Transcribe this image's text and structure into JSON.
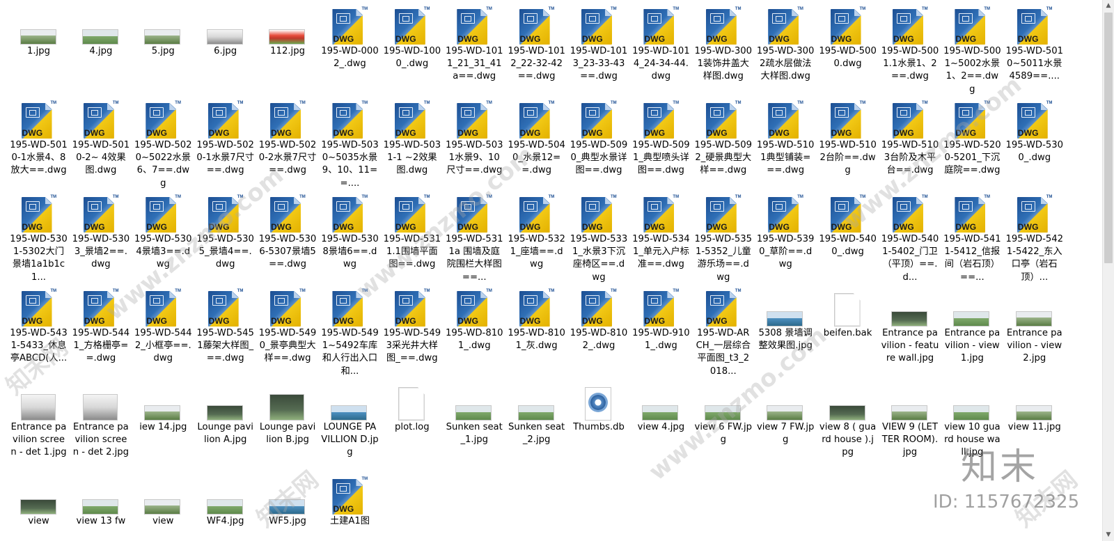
{
  "files": [
    {
      "name": "1.jpg",
      "type": "img",
      "thumb": "t2"
    },
    {
      "name": "4.jpg",
      "type": "img",
      "thumb": "t1"
    },
    {
      "name": "5.jpg",
      "type": "img",
      "thumb": "t2"
    },
    {
      "name": "6.jpg",
      "type": "img",
      "thumb": "t4"
    },
    {
      "name": "112.jpg",
      "type": "img",
      "thumb": "t6"
    },
    {
      "name": "195-WD-0002_.dwg",
      "type": "dwg"
    },
    {
      "name": "195-WD-1000_.dwg",
      "type": "dwg"
    },
    {
      "name": "195-WD-1011_21_31_41a==.dwg",
      "type": "dwg"
    },
    {
      "name": "195-WD-1012_22-32-42==.dwg",
      "type": "dwg"
    },
    {
      "name": "195-WD-1013_23-33-43==.dwg",
      "type": "dwg"
    },
    {
      "name": "195-WD-1014_24-34-44.dwg",
      "type": "dwg"
    },
    {
      "name": "195-WD-3001装饰井盖大样图.dwg",
      "type": "dwg"
    },
    {
      "name": "195-WD-3002疏水层做法大样图.dwg",
      "type": "dwg"
    },
    {
      "name": "195-WD-5000.dwg",
      "type": "dwg"
    },
    {
      "name": "195-WD-5001.1水景1、2==.dwg",
      "type": "dwg"
    },
    {
      "name": "195-WD-5001~5002水景1、2==.dwg",
      "type": "dwg"
    },
    {
      "name": "195-WD-5010~5011水景4589==....",
      "type": "dwg"
    },
    {
      "name": "195-WD-5010-1水景4、8放大==.dwg",
      "type": "dwg"
    },
    {
      "name": "195-WD-5010-2~ 4效果图.dwg",
      "type": "dwg"
    },
    {
      "name": "195-WD-5020~5022水景6、7==.dwg",
      "type": "dwg"
    },
    {
      "name": "195-WD-5020-1水景7尺寸==.dwg",
      "type": "dwg"
    },
    {
      "name": "195-WD-5020-2水景7尺寸==.dwg",
      "type": "dwg"
    },
    {
      "name": "195-WD-5030~5035水景9、10、11==....",
      "type": "dwg"
    },
    {
      "name": "195-WD-5031-1 ~2效果图.dwg",
      "type": "dwg"
    },
    {
      "name": "195-WD-5031水景9、10尺寸==.dwg",
      "type": "dwg"
    },
    {
      "name": "195-WD-5040_水景12==.dwg",
      "type": "dwg"
    },
    {
      "name": "195-WD-5090_典型水景详图==.dwg",
      "type": "dwg"
    },
    {
      "name": "195-WD-5091_典型喷头详图==.dwg",
      "type": "dwg"
    },
    {
      "name": "195-WD-5092_硬景典型大样==.dwg",
      "type": "dwg"
    },
    {
      "name": "195-WD-5101典型铺装===.dwg",
      "type": "dwg"
    },
    {
      "name": "195-WD-5102台阶==.dwg",
      "type": "dwg"
    },
    {
      "name": "195-WD-5103台阶及木平台==.dwg",
      "type": "dwg"
    },
    {
      "name": "195-WD-5200-5201_下沉庭院==.dwg",
      "type": "dwg"
    },
    {
      "name": "195-WD-5300_.dwg",
      "type": "dwg"
    },
    {
      "name": "195-WD-5301-5302大门景墙1a1b1c1...",
      "type": "dwg"
    },
    {
      "name": "195-WD-5303_景墙2==.dwg",
      "type": "dwg"
    },
    {
      "name": "195-WD-5304景墙3==.dwg",
      "type": "dwg"
    },
    {
      "name": "195-WD-5305_景墙4==.dwg",
      "type": "dwg"
    },
    {
      "name": "195-WD-5306-5307景墙5==.dwg",
      "type": "dwg"
    },
    {
      "name": "195-WD-5308景墙6==.dwg",
      "type": "dwg"
    },
    {
      "name": "195-WD-5311.1围墙平面图==.dwg",
      "type": "dwg"
    },
    {
      "name": "195-WD-5311a 围墙及庭院围栏大样图==...",
      "type": "dwg"
    },
    {
      "name": "195-WD-5321_座墙==.dwg",
      "type": "dwg"
    },
    {
      "name": "195-WD-5331_水景3下沉座椅区==.dwg",
      "type": "dwg"
    },
    {
      "name": "195-WD-5341_单元入户标准==.dwg",
      "type": "dwg"
    },
    {
      "name": "195-WD-5351-5352_儿童游乐场==.dwg",
      "type": "dwg"
    },
    {
      "name": "195-WD-5390_草阶==.dwg",
      "type": "dwg"
    },
    {
      "name": "195-WD-5400_.dwg",
      "type": "dwg"
    },
    {
      "name": "195-WD-5401-5402_门卫（平顶）==.d...",
      "type": "dwg"
    },
    {
      "name": "195-WD-5411-5412_信报间（岩石顶）==...",
      "type": "dwg"
    },
    {
      "name": "195-WD-5421-5422_东入口亭（岩石顶）...",
      "type": "dwg"
    },
    {
      "name": "195-WD-5431-5433_休息亭ABCD(人...",
      "type": "dwg"
    },
    {
      "name": "195-WD-5441_方格栅亭==.dwg",
      "type": "dwg"
    },
    {
      "name": "195-WD-5442_小框亭==.dwg",
      "type": "dwg"
    },
    {
      "name": "195-WD-5451藤架大样图_==.dwg",
      "type": "dwg"
    },
    {
      "name": "195-WD-5490_景亭典型大样==.dwg",
      "type": "dwg"
    },
    {
      "name": "195-WD-5491~5492车库和人行出入口和...",
      "type": "dwg"
    },
    {
      "name": "195-WD-5493采光井大样图_==.dwg",
      "type": "dwg"
    },
    {
      "name": "195-WD-8101_.dwg",
      "type": "dwg"
    },
    {
      "name": "195-WD-8101_灰.dwg",
      "type": "dwg"
    },
    {
      "name": "195-WD-8102_.dwg",
      "type": "dwg"
    },
    {
      "name": "195-WD-9101_.dwg",
      "type": "dwg"
    },
    {
      "name": "195-WD-ARCH_一层综合平面图_t3_2018...",
      "type": "dwg"
    },
    {
      "name": "5308 景墙调整效果图.jpg",
      "type": "img",
      "thumb": "t5"
    },
    {
      "name": "beifen.bak",
      "type": "blank"
    },
    {
      "name": "Entrance pavilion - feature wall.jpg",
      "type": "img",
      "thumb": "t3"
    },
    {
      "name": "Entrance pavilion - view 1.jpg",
      "type": "img",
      "thumb": "t1"
    },
    {
      "name": "Entrance pavilion - view 2.jpg",
      "type": "img",
      "thumb": "t2"
    },
    {
      "name": "Entrance pavilion screen - det 1.jpg",
      "type": "img",
      "thumb": "t4",
      "size": "sq"
    },
    {
      "name": "Entrance pavilion screen - det 2.jpg",
      "type": "img",
      "thumb": "t4",
      "size": "sq"
    },
    {
      "name": "iew 14.jpg",
      "type": "img",
      "thumb": "t2"
    },
    {
      "name": "Lounge pavilion A.jpg",
      "type": "img",
      "thumb": "t3"
    },
    {
      "name": "Lounge pavilion B.jpg",
      "type": "img",
      "thumb": "t3",
      "size": "sq"
    },
    {
      "name": "LOUNGE PAVILLION D.jpg",
      "type": "img",
      "thumb": "t5"
    },
    {
      "name": "plot.log",
      "type": "blank"
    },
    {
      "name": "Sunken seat_1.jpg",
      "type": "img",
      "thumb": "t1"
    },
    {
      "name": "Sunken seat_2.jpg",
      "type": "img",
      "thumb": "t1"
    },
    {
      "name": "Thumbs.db",
      "type": "gear"
    },
    {
      "name": "view 4.jpg",
      "type": "img",
      "thumb": "t1"
    },
    {
      "name": "view 6 FW.jpg",
      "type": "img",
      "thumb": "t1"
    },
    {
      "name": "view 7 FW.jpg",
      "type": "img",
      "thumb": "t2"
    },
    {
      "name": "view 8 ( guard house ).jpg",
      "type": "img",
      "thumb": "t3"
    },
    {
      "name": "VIEW 9 (LETTER ROOM).jpg",
      "type": "img",
      "thumb": "t2"
    },
    {
      "name": "view 10 guard house wall.jpg",
      "type": "img",
      "thumb": "t1"
    },
    {
      "name": "view 11.jpg",
      "type": "img",
      "thumb": "t2"
    },
    {
      "name": "view",
      "type": "img",
      "thumb": "t3"
    },
    {
      "name": "view 13 fw",
      "type": "img",
      "thumb": "t1"
    },
    {
      "name": "view",
      "type": "img",
      "thumb": "t2"
    },
    {
      "name": "WF4.jpg",
      "type": "img",
      "thumb": "t1"
    },
    {
      "name": "WF5.jpg",
      "type": "img",
      "thumb": "t5"
    },
    {
      "name": "土建A1图",
      "type": "dwg"
    }
  ],
  "icon_labels": {
    "dwg_tag": "DWG",
    "dwg_tm": "TM"
  },
  "colors": {
    "dwg_blue": "#1d4f93",
    "dwg_yellow": "#f2c916",
    "background": "#ffffff"
  },
  "watermark": {
    "logo": "知末",
    "id": "ID: 1157672325",
    "site": "www.znzmo.com",
    "brand": "知末网"
  }
}
